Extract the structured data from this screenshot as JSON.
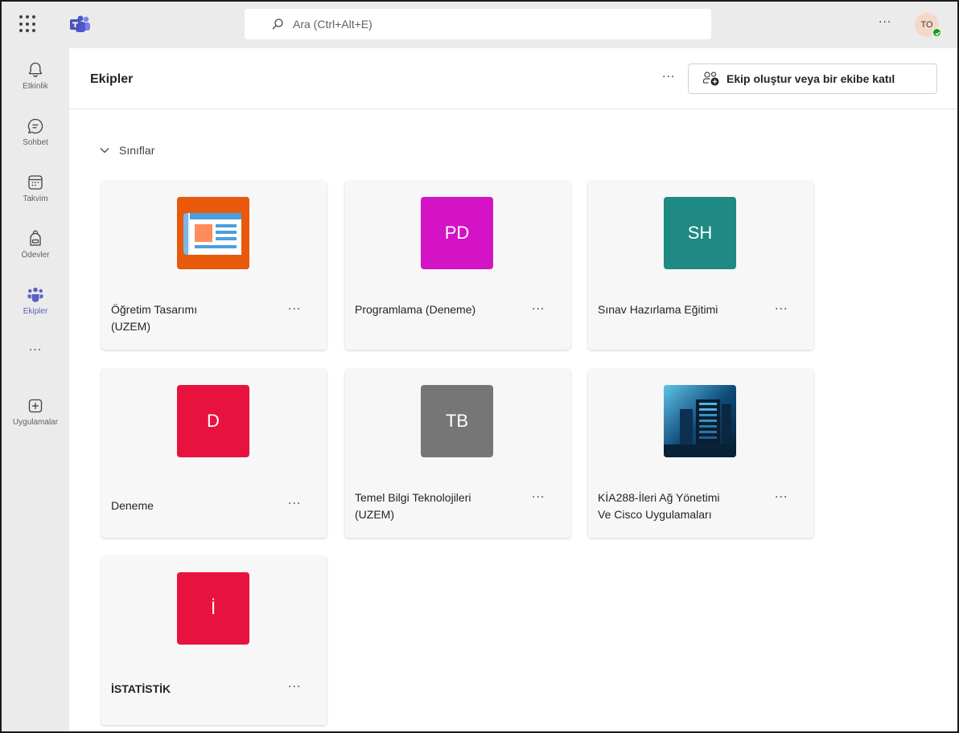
{
  "topbar": {
    "search_placeholder": "Ara (Ctrl+Alt+E)",
    "more_label": "···",
    "avatar_initials": "TO"
  },
  "rail": {
    "items": [
      {
        "label": "Etkinlik",
        "icon": "bell-icon"
      },
      {
        "label": "Sohbet",
        "icon": "chat-icon"
      },
      {
        "label": "Takvim",
        "icon": "calendar-icon"
      },
      {
        "label": "Ödevler",
        "icon": "backpack-icon"
      },
      {
        "label": "Ekipler",
        "icon": "teams-icon",
        "active": true
      },
      {
        "label": "Uygulamalar",
        "icon": "add-apps-icon"
      }
    ],
    "more_label": "···"
  },
  "header": {
    "title": "Ekipler",
    "more_label": "···",
    "create_button_label": "Ekip oluştur veya bir ekibe katıl"
  },
  "section": {
    "label": "Sınıflar"
  },
  "teams": [
    {
      "name_line1": "Öğretim Tasarımı",
      "name_line2": "(UZEM)",
      "tile_type": "image-news",
      "tile_color": "#e8590c"
    },
    {
      "name_line1": "Programlama (Deneme)",
      "name_line2": "",
      "tile_initials": "PD",
      "tile_color": "#d412c6"
    },
    {
      "name_line1": "Sınav Hazırlama Eğitimi",
      "name_line2": "",
      "tile_initials": "SH",
      "tile_color": "#1e8a83"
    },
    {
      "name_line1": "Deneme",
      "name_line2": "",
      "tile_initials": "D",
      "tile_color": "#e8123e"
    },
    {
      "name_line1": "Temel Bilgi Teknolojileri",
      "name_line2": "(UZEM)",
      "tile_initials": "TB",
      "tile_color": "#767676"
    },
    {
      "name_line1": "KİA288-İleri Ağ Yönetimi",
      "name_line2": "Ve Cisco Uygulamaları",
      "tile_type": "image-servers",
      "tile_color": "#0b2a4a"
    },
    {
      "name_line1": "İSTATİSTİK",
      "name_line2": "",
      "tile_initials": "İ",
      "tile_color": "#e8123e"
    }
  ],
  "card_more_label": "···",
  "colors": {
    "accent": "#5b5fc7",
    "presence": "#13a10e"
  }
}
